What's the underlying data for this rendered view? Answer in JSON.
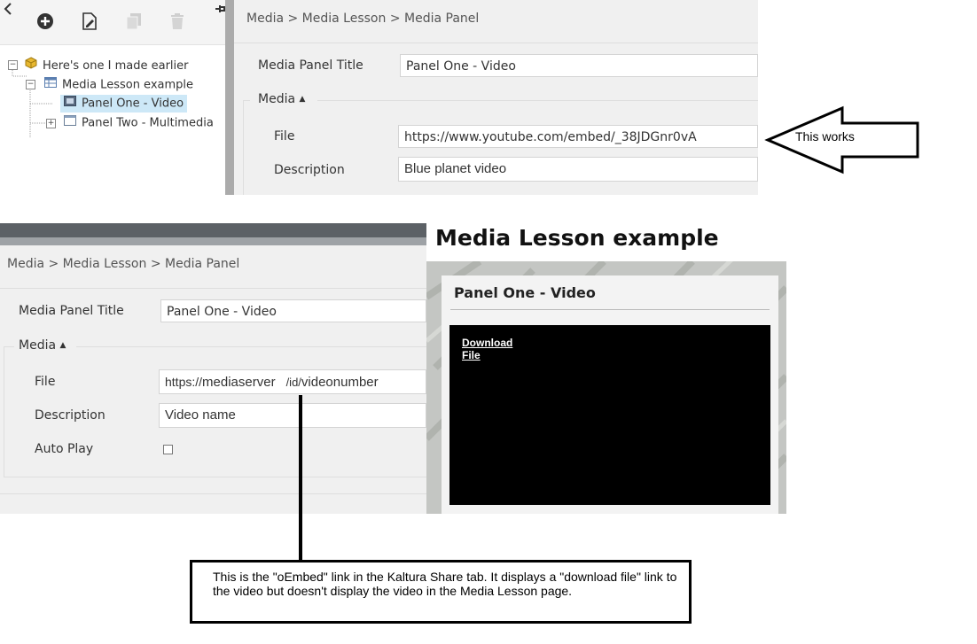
{
  "tree_panel": {
    "toolbar": {
      "back_icon": "chevron-left-icon",
      "add_icon": "add-circle-icon",
      "edit_icon": "edit-document-icon",
      "copy_icon": "copy-icon",
      "delete_icon": "trash-icon",
      "pin_icon": "pin-icon"
    },
    "nodes": [
      {
        "label": "Here's one I made earlier",
        "icon": "package-icon"
      },
      {
        "label": "Media Lesson example",
        "icon": "table-icon"
      },
      {
        "label": "Panel One - Video",
        "icon": "video-icon",
        "selected": true
      },
      {
        "label": "Panel Two - Multimedia",
        "icon": "window-icon"
      }
    ]
  },
  "top_editor": {
    "breadcrumb": "Media > Media Lesson > Media Panel",
    "title_label": "Media Panel Title",
    "title_value": "Panel One - Video",
    "media_section": "Media",
    "file_label": "File",
    "file_value": "https://www.youtube.com/embed/_38JDGnr0vA",
    "description_label": "Description",
    "description_value": "Blue planet video"
  },
  "arrow_annotation": {
    "text": "This works"
  },
  "bottom_editor": {
    "breadcrumb": "Media > Media Lesson > Media Panel",
    "title_label": "Media Panel Title",
    "title_value": "Panel One - Video",
    "media_section": "Media",
    "file_label": "File",
    "file_value_parts": [
      "https://",
      "mediaserver",
      "/id/",
      "videonumber"
    ],
    "description_label": "Description",
    "description_value": "Video name",
    "autoplay_label": "Auto Play",
    "autoplay_checked": false
  },
  "preview": {
    "page_title": "Media Lesson example",
    "panel_title": "Panel One - Video",
    "download_link": "Download File"
  },
  "callout": {
    "text": "This is the \"oEmbed\" link in the Kaltura Share tab. It displays a \"download file\" link to the video but doesn't display the video in the Media Lesson page."
  },
  "colors": {
    "selected_bg": "#cde8f7",
    "editor_bg": "#f0f0f0",
    "divider": "#ababab",
    "video_bg": "#000000"
  }
}
